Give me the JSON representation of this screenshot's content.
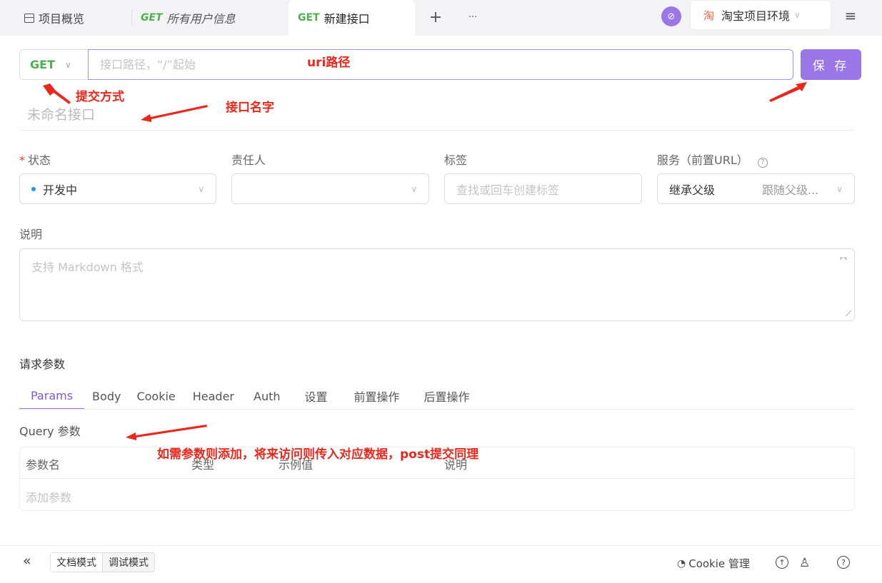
{
  "tabs": [
    {
      "label": "项目概览",
      "icon": "overview-icon"
    },
    {
      "method": "GET",
      "label": "所有用户信息"
    },
    {
      "method": "GET",
      "label": "新建接口"
    }
  ],
  "toolbar": {
    "add": "+",
    "more": "···",
    "menu": "≡"
  },
  "environment": {
    "badge": "淘",
    "name": "淘宝项目环境"
  },
  "request": {
    "method": "GET",
    "path_placeholder": "接口路径，“/”起始",
    "save_label": "保 存",
    "name_placeholder": "未命名接口"
  },
  "fields": {
    "status": {
      "label": "状态",
      "required_mark": "*",
      "value": "开发中",
      "dot_color": "#2196f3"
    },
    "owner": {
      "label": "责任人"
    },
    "tags": {
      "label": "标签",
      "placeholder": "查找或回车创建标签"
    },
    "service": {
      "label": "服务（前置URL）",
      "value": "继承父级",
      "hint": "跟随父级..."
    }
  },
  "description": {
    "label": "说明",
    "placeholder": "支持 Markdown 格式"
  },
  "params": {
    "section_title": "请求参数",
    "tabs": [
      "Params",
      "Body",
      "Cookie",
      "Header",
      "Auth",
      "设置",
      "前置操作",
      "后置操作"
    ],
    "active_tab": "Params",
    "query_label": "Query 参数",
    "columns": [
      "参数名",
      "类型",
      "示例值",
      "说明"
    ],
    "add_placeholder": "添加参数"
  },
  "annotations": {
    "uri": "uri路径",
    "method": "提交方式",
    "name": "接口名字",
    "params": "如需参数则添加，将来访问则传入对应数据，post提交同理"
  },
  "bottom": {
    "collapse": "«",
    "modes": [
      "文档模式",
      "调试模式"
    ],
    "cookie_label": "Cookie 管理"
  },
  "colors": {
    "accent": "#9b76e6",
    "get": "#4caf50",
    "annotation": "#e8281c"
  }
}
